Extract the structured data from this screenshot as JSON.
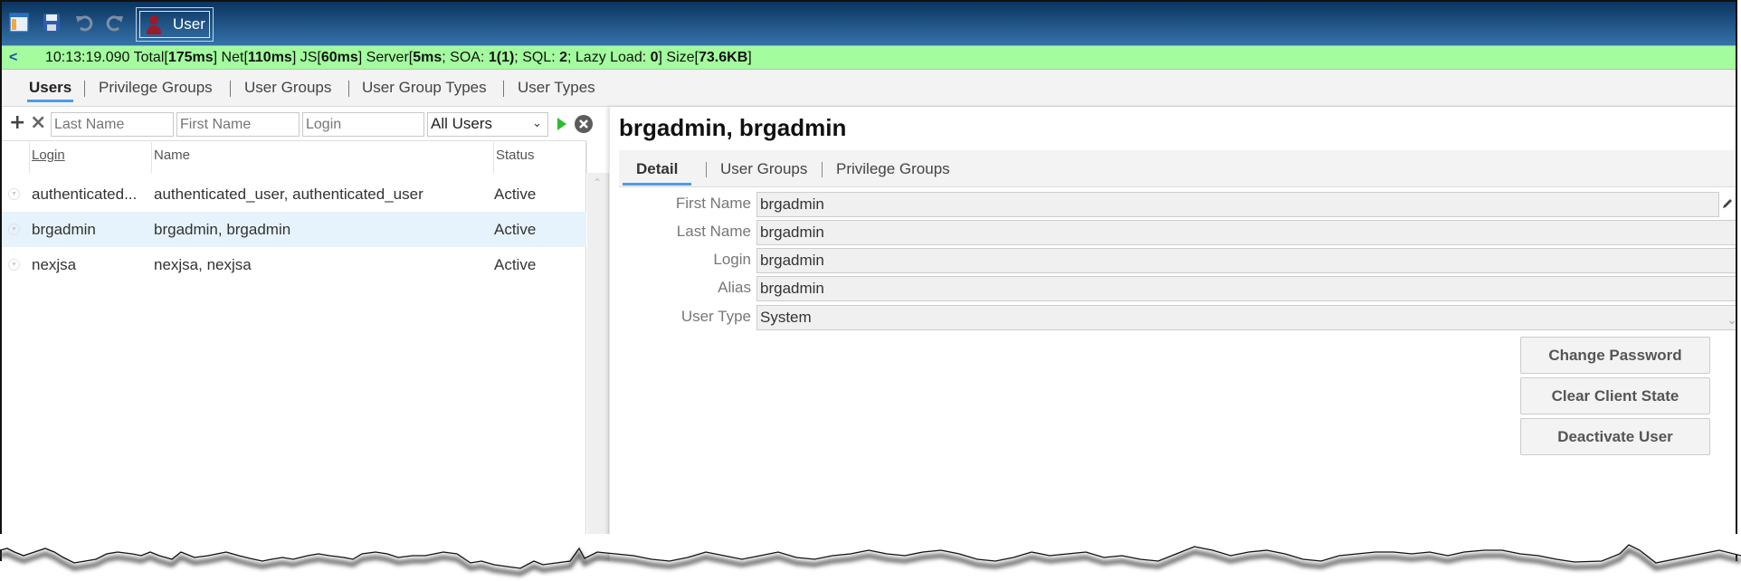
{
  "toolbar": {
    "icons": [
      "app-menu-icon",
      "save-icon",
      "undo-icon",
      "redo-icon"
    ],
    "user_button_label": "User",
    "user_icon_color": "#9b1b2a"
  },
  "statusbar": {
    "back_label": "<",
    "time": "10:13:19.090",
    "total": "175ms",
    "net": "110ms",
    "js": "60ms",
    "server": "5ms",
    "soa": "1(1)",
    "sql": "2",
    "lazy_load": "0",
    "size": "73.6KB",
    "background": "#a3fd9e"
  },
  "main_tabs": [
    {
      "label": "Users",
      "active": true
    },
    {
      "label": "Privilege Groups",
      "active": false
    },
    {
      "label": "User Groups",
      "active": false
    },
    {
      "label": "User Group Types",
      "active": false
    },
    {
      "label": "User Types",
      "active": false
    }
  ],
  "filter": {
    "add_label": "+",
    "delete_label": "×",
    "last_name_placeholder": "Last Name",
    "first_name_placeholder": "First Name",
    "login_placeholder": "Login",
    "scope_selected": "All Users"
  },
  "grid": {
    "columns": [
      "Login",
      "Name",
      "Status"
    ],
    "rows": [
      {
        "login": "authenticated...",
        "name": "authenticated_user, authenticated_user",
        "status": "Active",
        "selected": false
      },
      {
        "login": "brgadmin",
        "name": "brgadmin, brgadmin",
        "status": "Active",
        "selected": true
      },
      {
        "login": "nexjsa",
        "name": "nexjsa, nexjsa",
        "status": "Active",
        "selected": false
      }
    ]
  },
  "detail": {
    "title": "brgadmin, brgadmin",
    "tabs": [
      {
        "label": "Detail",
        "active": true
      },
      {
        "label": "User Groups",
        "active": false
      },
      {
        "label": "Privilege Groups",
        "active": false
      }
    ],
    "fields": [
      {
        "label": "First Name",
        "value": "brgadmin"
      },
      {
        "label": "Last Name",
        "value": "brgadmin"
      },
      {
        "label": "Login",
        "value": "brgadmin"
      },
      {
        "label": "Alias",
        "value": "brgadmin"
      },
      {
        "label": "User Type",
        "value": "System"
      }
    ],
    "actions": [
      "Change Password",
      "Clear Client State",
      "Deactivate User"
    ]
  },
  "colors": {
    "accent_tab_underline": "#4a9ee8",
    "selected_row": "#e6f3fc",
    "run_green": "#2ebd2e"
  }
}
